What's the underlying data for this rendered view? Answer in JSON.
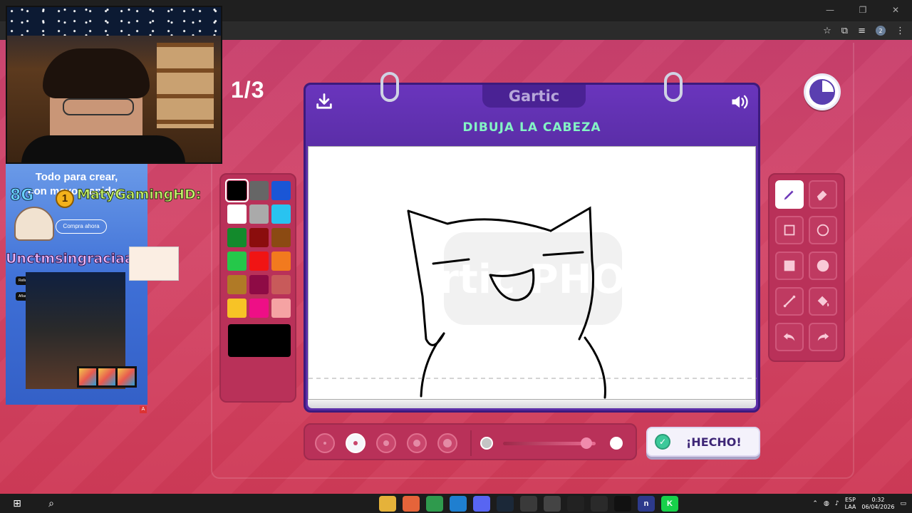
{
  "browser": {
    "minimize": "—",
    "restore": "❐",
    "close": "✕",
    "profile_initial": "2"
  },
  "game": {
    "round": "1/3",
    "logo": "Gartic",
    "instruction": "DIBUJA LA CABEZA",
    "done_button": "¡HECHO!",
    "watermark": "Gartic PHONE",
    "colors": [
      [
        "#000000",
        "#666666",
        "#1a56d6"
      ],
      [
        "#ffffff",
        "#aaaaaa",
        "#29c3f0"
      ],
      [
        "#138a2c",
        "#8b0d0d",
        "#8b4a12"
      ],
      [
        "#25c84a",
        "#f01414",
        "#f27a1e"
      ],
      [
        "#b07a26",
        "#8e0b45",
        "#c85a5a"
      ],
      [
        "#f7c326",
        "#ee0f86",
        "#f5a3a3"
      ]
    ],
    "selected_color": "#000000",
    "brush_sizes": [
      1,
      2,
      3,
      4,
      5
    ],
    "selected_brush": 2,
    "opacity_percent": 90,
    "tools": [
      [
        "pencil-icon",
        "eraser-icon"
      ],
      [
        "rectangle-outline-icon",
        "ellipse-outline-icon"
      ],
      [
        "rectangle-filled-icon",
        "ellipse-filled-icon"
      ],
      [
        "line-icon",
        "fill-bucket-icon"
      ],
      [
        "undo-icon",
        "redo-icon"
      ]
    ],
    "active_tool": "pencil-icon"
  },
  "overlay": {
    "ad_title": "Todo para crear,",
    "ad_sub": "con mayor rapidez.",
    "ad_cta": "Compra ahora",
    "ad_chip1": "Relleno generativo",
    "ad_chip2": "Añade graffiti a la pared",
    "ad_badge": "A",
    "chat_badge_text": "8G",
    "chat_level": "1",
    "chat_user1": "MatyGamingHD:",
    "chat_user2": "Unctmsingraciaa:"
  },
  "taskbar": {
    "lang_top": "ESP",
    "lang_bottom": "LAA",
    "time": "0:32",
    "date": "06/04/2026",
    "apps": [
      {
        "icon": "file-explorer-icon",
        "color": "#e5b23a",
        "label": ""
      },
      {
        "icon": "firefox-icon",
        "color": "#e5643a",
        "label": ""
      },
      {
        "icon": "chrome-icon",
        "color": "#2f9a4d",
        "label": ""
      },
      {
        "icon": "edge-icon",
        "color": "#1f7fd0",
        "label": ""
      },
      {
        "icon": "discord-icon",
        "color": "#5865f2",
        "label": ""
      },
      {
        "icon": "steam-icon",
        "color": "#1b2838",
        "label": ""
      },
      {
        "icon": "obs-icon",
        "color": "#3a3a3a",
        "label": ""
      },
      {
        "icon": "calculator-icon",
        "color": "#444444",
        "label": ""
      },
      {
        "icon": "recorder-icon",
        "color": "#222222",
        "label": ""
      },
      {
        "icon": "play-icon",
        "color": "#2a2a2a",
        "label": ""
      },
      {
        "icon": "terminal-icon",
        "color": "#111111",
        "label": ""
      },
      {
        "icon": "n-app-icon",
        "color": "#2d3a8c",
        "label": "n"
      },
      {
        "icon": "kick-icon",
        "color": "#17d14a",
        "label": "K"
      }
    ]
  }
}
